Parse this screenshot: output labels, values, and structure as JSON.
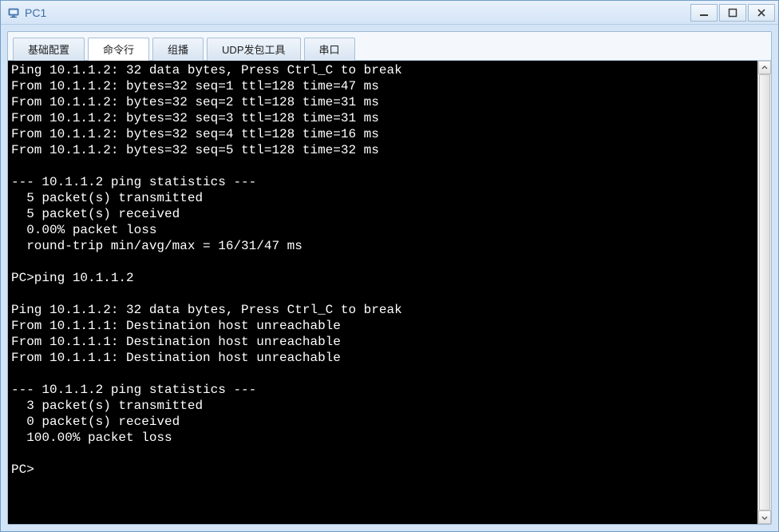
{
  "window": {
    "title": "PC1"
  },
  "tabs": {
    "items": [
      {
        "label": "基础配置"
      },
      {
        "label": "命令行"
      },
      {
        "label": "组播"
      },
      {
        "label": "UDP发包工具"
      },
      {
        "label": "串口"
      }
    ],
    "active_index": 1
  },
  "terminal": {
    "lines": [
      "Ping 10.1.1.2: 32 data bytes, Press Ctrl_C to break",
      "From 10.1.1.2: bytes=32 seq=1 ttl=128 time=47 ms",
      "From 10.1.1.2: bytes=32 seq=2 ttl=128 time=31 ms",
      "From 10.1.1.2: bytes=32 seq=3 ttl=128 time=31 ms",
      "From 10.1.1.2: bytes=32 seq=4 ttl=128 time=16 ms",
      "From 10.1.1.2: bytes=32 seq=5 ttl=128 time=32 ms",
      "",
      "--- 10.1.1.2 ping statistics ---",
      "  5 packet(s) transmitted",
      "  5 packet(s) received",
      "  0.00% packet loss",
      "  round-trip min/avg/max = 16/31/47 ms",
      "",
      "PC>ping 10.1.1.2",
      "",
      "Ping 10.1.1.2: 32 data bytes, Press Ctrl_C to break",
      "From 10.1.1.1: Destination host unreachable",
      "From 10.1.1.1: Destination host unreachable",
      "From 10.1.1.1: Destination host unreachable",
      "",
      "--- 10.1.1.2 ping statistics ---",
      "  3 packet(s) transmitted",
      "  0 packet(s) received",
      "  100.00% packet loss",
      "",
      "PC>"
    ]
  }
}
